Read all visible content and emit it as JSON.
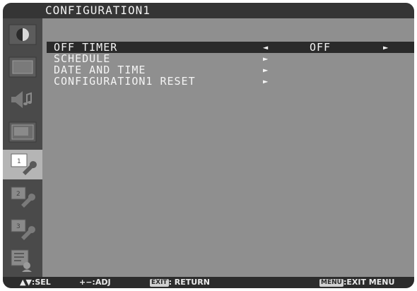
{
  "title": "CONFIGURATION1",
  "sidebar": {
    "items": [
      {
        "icon": "picture-icon"
      },
      {
        "icon": "screen-icon"
      },
      {
        "icon": "audio-icon"
      },
      {
        "icon": "pip-icon"
      },
      {
        "icon": "configuration1-icon",
        "active": true
      },
      {
        "icon": "configuration2-icon"
      },
      {
        "icon": "configuration3-icon"
      },
      {
        "icon": "advanced-option-icon"
      }
    ]
  },
  "menu": {
    "items": [
      {
        "label": "OFF TIMER",
        "value": "OFF",
        "arrow_left": "◄",
        "arrow_right": "►"
      },
      {
        "label": "SCHEDULE",
        "arrow_right": "►"
      },
      {
        "label": "DATE AND TIME",
        "arrow_right": "►"
      },
      {
        "label": "CONFIGURATION1 RESET",
        "arrow_right": "►"
      }
    ]
  },
  "footer": {
    "sel_icon": "▲▼",
    "sel_label": ":SEL",
    "adj_label": "+−:ADJ",
    "exit_key": "EXIT",
    "exit_label": ": RETURN",
    "menu_key": "MENU",
    "menu_label": ":EXIT MENU"
  },
  "colors": {
    "background": "#8f8f8f",
    "title_bar": "#353535",
    "sidebar": "#4a4a4a",
    "selected_row": "#2a2a2a",
    "text": "#f4f4f4"
  }
}
